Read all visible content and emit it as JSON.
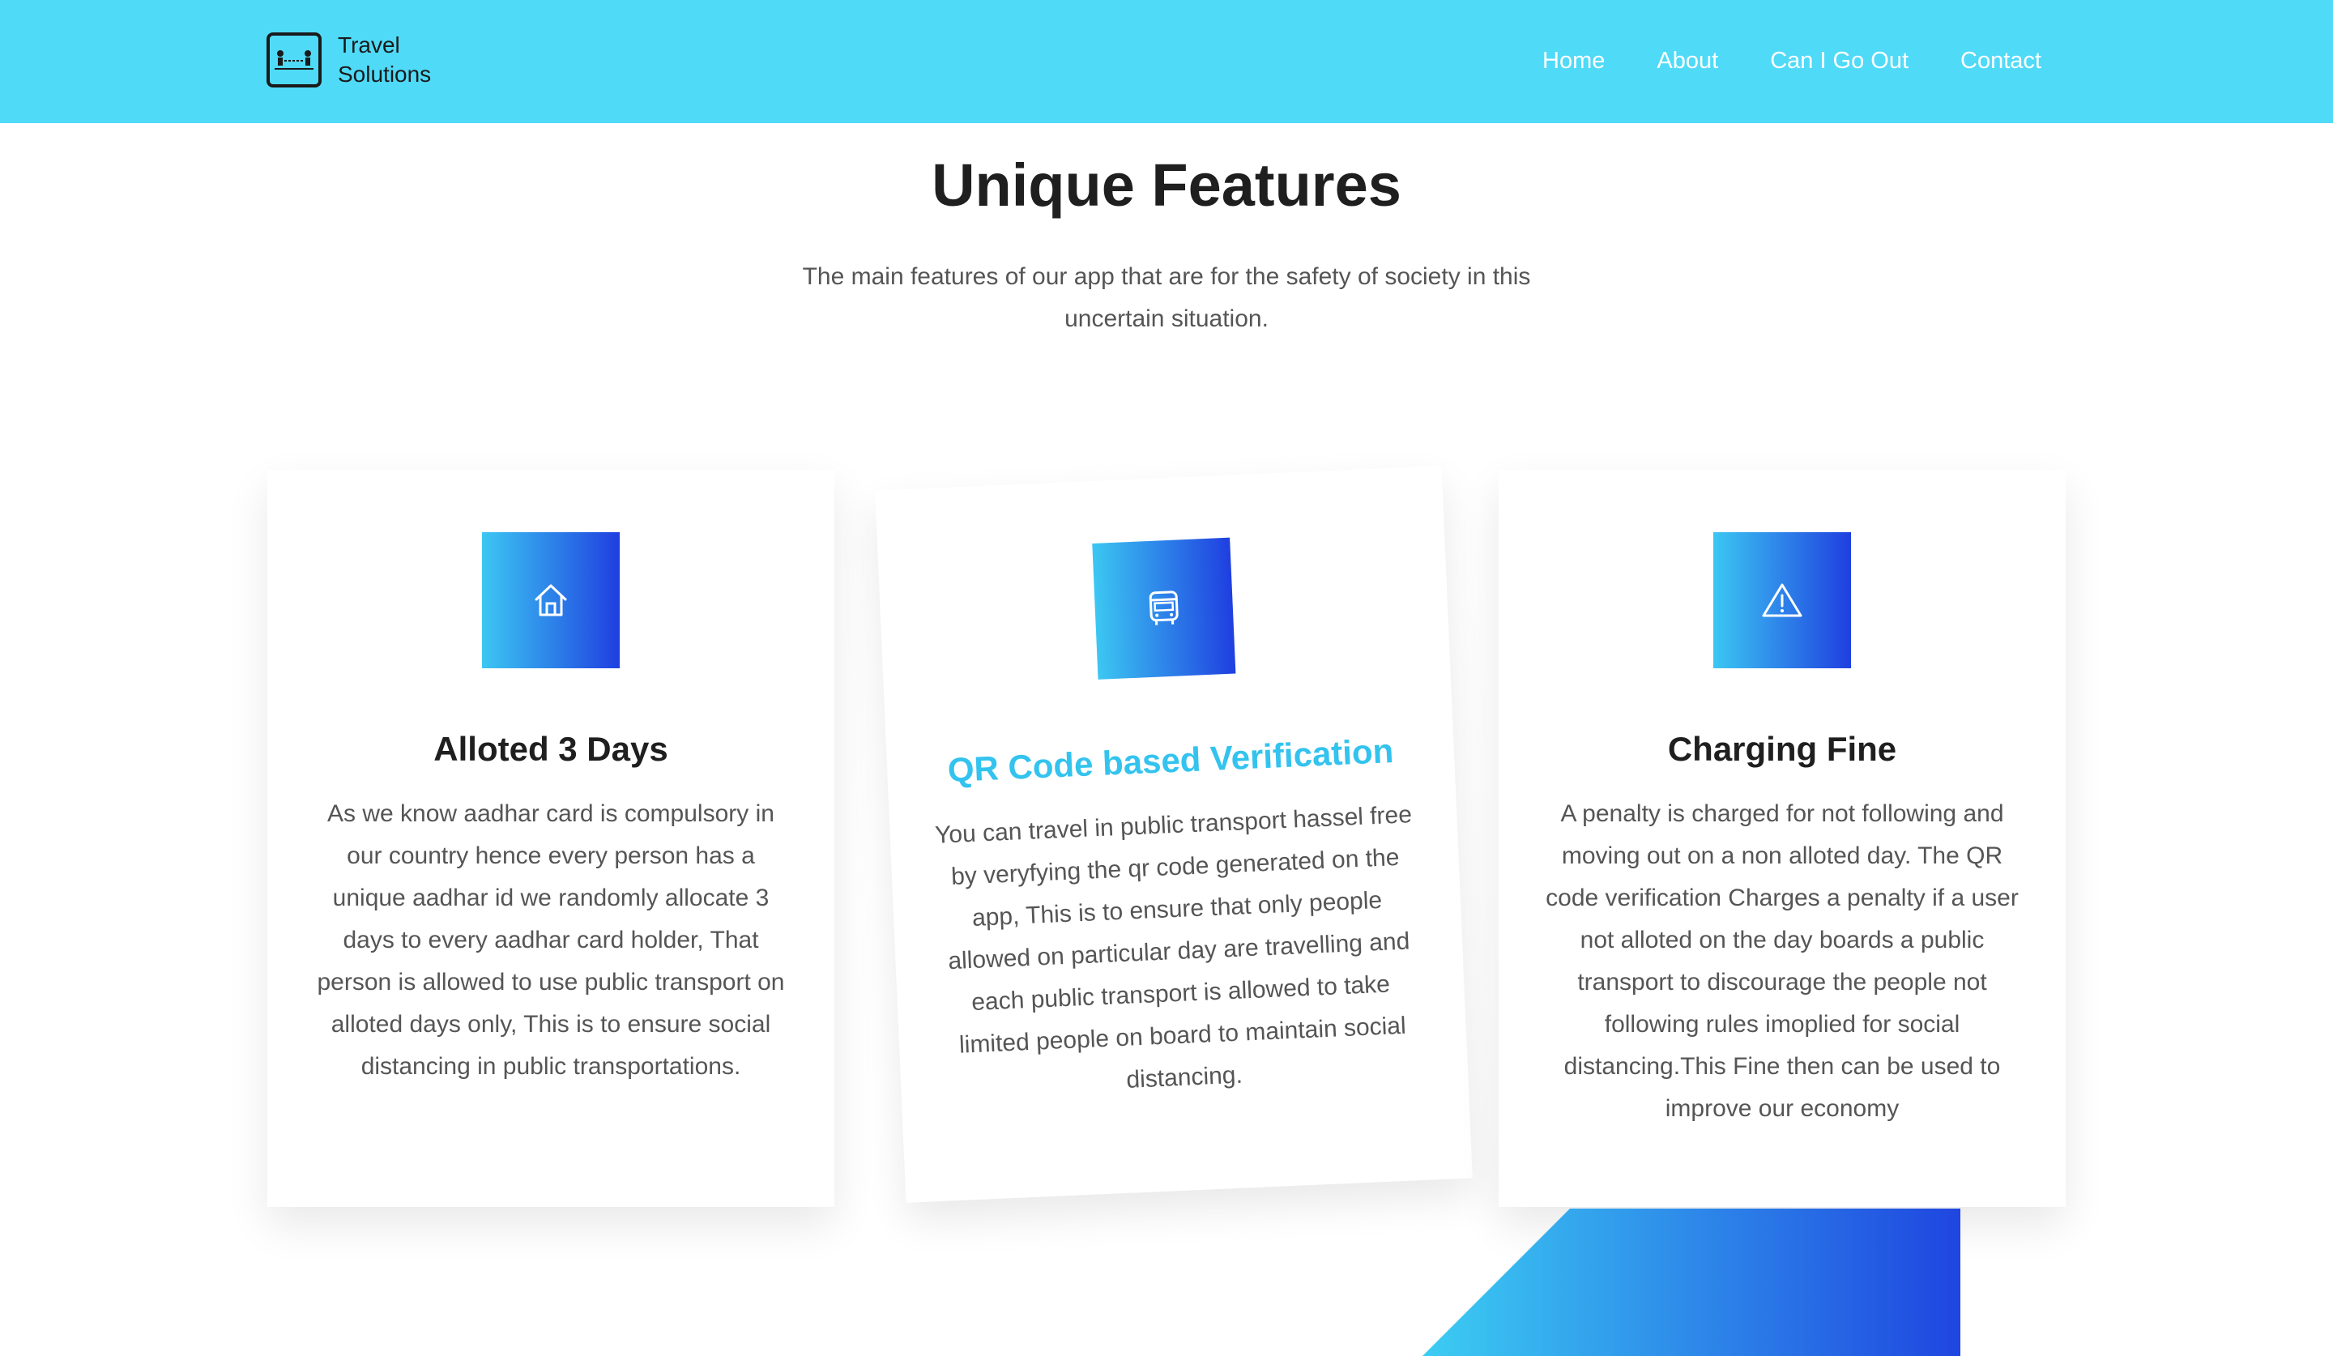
{
  "header": {
    "logo_line1": "Travel",
    "logo_line2": "Solutions",
    "logo_icon": "travel-people-icon",
    "nav": [
      "Home",
      "About",
      "Can I Go Out",
      "Contact"
    ]
  },
  "section": {
    "title": "Unique Features",
    "subtitle": "The main features of our app that are for the safety of society in this uncertain situation."
  },
  "cards": [
    {
      "icon": "home-icon",
      "title": "Alloted 3 Days",
      "text": "As we know aadhar card is compulsory in our country hence every person has a unique aadhar id we randomly allocate 3 days to every aadhar card holder, That person is allowed to use public transport on alloted days only, This is to ensure social distancing in public transportations."
    },
    {
      "icon": "bus-icon",
      "title": "QR Code based Verification",
      "text": "You can travel in public transport hassel free by veryfying the qr code generated on the app, This is to ensure that only people allowed on particular day are travelling and each public transport is allowed to take limited people on board to maintain social distancing."
    },
    {
      "icon": "warning-icon",
      "title": "Charging Fine",
      "text": "A penalty is charged for not following and moving out on a non alloted day. The QR code verification Charges a penalty if a user not alloted on the day boards a public transport to discourage the people not following rules imoplied for social distancing.This Fine then can be used to improve our economy"
    }
  ],
  "colors": {
    "header_bg": "#4fdaf8",
    "accent": "#33c3ee",
    "gradient_start": "#3cc7f2",
    "gradient_end": "#1f3fe0"
  }
}
